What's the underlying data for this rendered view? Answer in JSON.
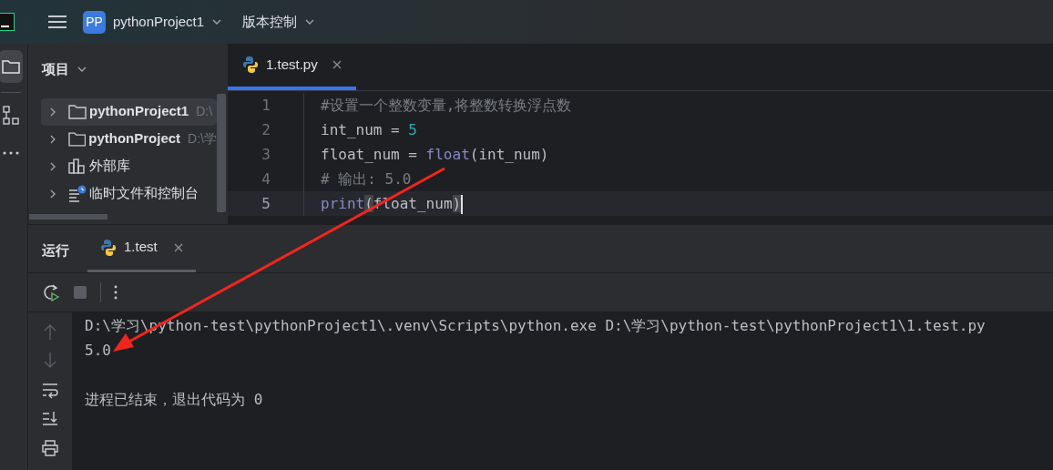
{
  "top_bar": {
    "project_badge": "PP",
    "project_name": "pythonProject1",
    "vcs_menu": "版本控制"
  },
  "project_panel": {
    "title": "项目",
    "items": [
      {
        "kind": "folder",
        "label": "pythonProject1",
        "path": "D:\\",
        "selected": true,
        "expanded": false
      },
      {
        "kind": "folder",
        "label": "pythonProject",
        "path": "D:\\学",
        "selected": false,
        "expanded": false
      },
      {
        "kind": "library",
        "label": "外部库",
        "selected": false,
        "expanded": false
      },
      {
        "kind": "scratch",
        "label": "临时文件和控制台",
        "selected": false,
        "expanded": false
      }
    ]
  },
  "editor": {
    "tabs": [
      {
        "label": "1.test.py",
        "selected": true
      }
    ],
    "lines": [
      {
        "number": "1",
        "current": false,
        "tokens": [
          {
            "text": "#设置一个整数变量,将整数转换浮点数",
            "kind": "comment"
          }
        ]
      },
      {
        "number": "2",
        "current": false,
        "tokens": [
          {
            "text": "int_num = ",
            "kind": "plain"
          },
          {
            "text": "5",
            "kind": "number"
          }
        ]
      },
      {
        "number": "3",
        "current": false,
        "tokens": [
          {
            "text": "float_num = ",
            "kind": "plain"
          },
          {
            "text": "float",
            "kind": "builtin"
          },
          {
            "text": "(int_num)",
            "kind": "plain"
          }
        ]
      },
      {
        "number": "4",
        "current": false,
        "tokens": [
          {
            "text": "# 输出: 5.0",
            "kind": "comment"
          }
        ]
      },
      {
        "number": "5",
        "current": true,
        "tokens": [
          {
            "text": "print",
            "kind": "builtin"
          },
          {
            "text": "(",
            "kind": "brace"
          },
          {
            "text": "float_num",
            "kind": "plain"
          },
          {
            "text": ")",
            "kind": "brace"
          }
        ]
      }
    ]
  },
  "run_panel": {
    "title": "运行",
    "tabs": [
      {
        "label": "1.test",
        "selected": true
      }
    ],
    "console": [
      {
        "text": "D:\\学习\\python-test\\pythonProject1\\.venv\\Scripts\\python.exe D:\\学习\\python-test\\pythonProject1\\1.test.py",
        "kind": "command"
      },
      {
        "text": "5.0",
        "kind": "output"
      },
      {
        "text": "进程已结束，退出代码为 0",
        "kind": "exit"
      }
    ]
  }
}
